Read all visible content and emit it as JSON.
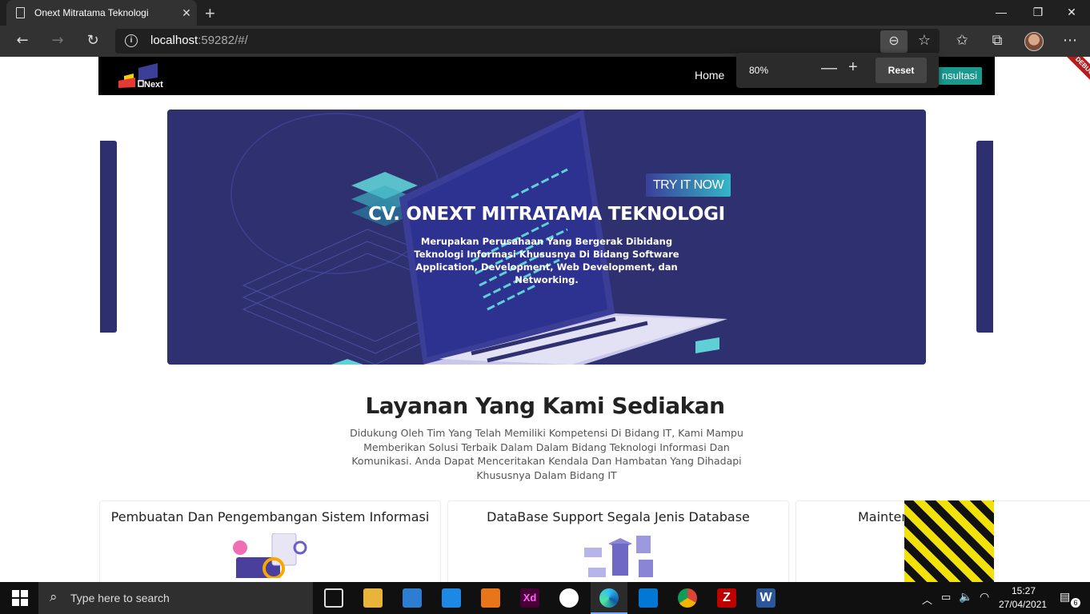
{
  "browser": {
    "tab_title": "Onext Mitratama Teknologi",
    "tab_close": "✕",
    "new_tab": "+",
    "url_host": "localhost",
    "url_rest": ":59282/#/",
    "zoom": {
      "percent": "80%",
      "minus": "—",
      "plus": "+",
      "reset": "Reset"
    }
  },
  "site": {
    "logo_text": "Next",
    "nav_home": "Home",
    "nav_consult": "nsultasi",
    "debug_ribbon": "DEBUG",
    "hero": {
      "cta": "TRY IT NOW",
      "title": "CV. ONEXT MITRATAMA TEKNOLOGI",
      "subtitle": "Merupakan Perusahaan Yang Bergerak Dibidang Teknologi Informasi Khususnya Di Bidang Software Application, Development, Web Development, dan Networking."
    },
    "services": {
      "title": "Layanan Yang Kami Sediakan",
      "description": "Didukung Oleh Tim Yang Telah Memiliki Kompetensi Di Bidang IT, Kami Mampu Memberikan Solusi Terbaik Dalam Dalam Bidang Teknologi Informasi Dan Komunikasi. Anda Dapat Menceritakan Kendala Dan Hambatan Yang Dihadapi Khususnya Dalam Bidang IT",
      "cards": [
        {
          "title": "Pembuatan Dan Pengembangan Sistem Informasi"
        },
        {
          "title": "DataBase Support Segala Jenis Database"
        },
        {
          "title": "Mainten"
        }
      ]
    }
  },
  "taskbar": {
    "search_placeholder": "Type here to search",
    "time": "15:27",
    "date": "27/04/2021",
    "notifications": "6"
  }
}
